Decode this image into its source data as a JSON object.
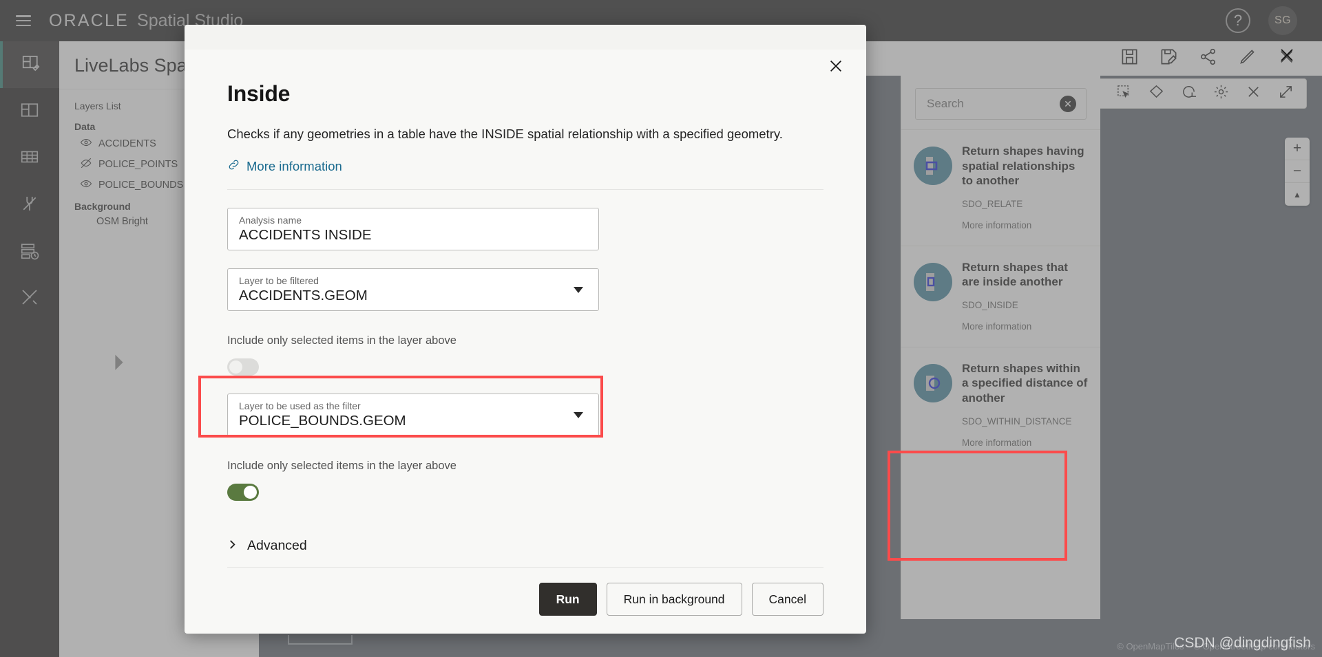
{
  "topbar": {
    "brand": "ORACLE",
    "brand_sub": "Spatial Studio",
    "help_glyph": "?",
    "avatar_initials": "SG"
  },
  "sidebar": {
    "rail_items": [
      {
        "name": "project-edit-icon",
        "active": true
      },
      {
        "name": "dataset-icon",
        "active": false
      },
      {
        "name": "table-icon",
        "active": false
      },
      {
        "name": "connection-icon",
        "active": false
      },
      {
        "name": "jobs-icon",
        "active": false
      },
      {
        "name": "tools-icon",
        "active": false
      }
    ],
    "project_title": "LiveLabs Spatial Studio",
    "layers_list_label": "Layers List",
    "groups": [
      {
        "label": "Data",
        "layers": [
          {
            "name": "ACCIDENTS",
            "visible": true
          },
          {
            "name": "POLICE_POINTS",
            "visible": false
          },
          {
            "name": "POLICE_BOUNDS",
            "visible": true
          }
        ]
      },
      {
        "label": "Background",
        "layers": [
          {
            "name": "OSM Bright",
            "visible": null
          }
        ]
      }
    ]
  },
  "map": {
    "toolbar_top_icons": [
      "save-icon",
      "save-as-icon",
      "share-icon",
      "edit-icon",
      "close-icon"
    ],
    "toolbar_secondary_icons": [
      "measure-icon",
      "box-select-icon",
      "shape-select-icon",
      "refresh-icon",
      "gear-icon",
      "clear-icon",
      "expand-icon"
    ],
    "zoom_in": "+",
    "zoom_out": "−",
    "zoom_reset": "▲",
    "attribution": [
      "© OpenMapTiles",
      "© OpenStreetMap contributors"
    ]
  },
  "analysis_panel": {
    "search": {
      "value": "",
      "placeholder": "Search"
    },
    "clear_glyph": "✕",
    "cards": [
      {
        "title": "Return shapes having spatial relationships to another",
        "code": "SDO_RELATE",
        "more": "More information",
        "highlighted": false
      },
      {
        "title": "Return shapes that are inside another",
        "code": "SDO_INSIDE",
        "more": "More information",
        "highlighted": false
      },
      {
        "title": "Return shapes within a specified distance of another",
        "code": "SDO_WITHIN_DISTANCE",
        "more": "More information",
        "highlighted": true
      }
    ]
  },
  "modal": {
    "title": "Inside",
    "description": "Checks if any geometries in a table have the INSIDE spatial relationship with a specified geometry.",
    "more_information": "More information",
    "fields": [
      {
        "label": "Analysis name",
        "value": "ACCIDENTS INSIDE",
        "type": "text",
        "name": "analysis-name-field"
      },
      {
        "label": "Layer to be filtered",
        "value": "ACCIDENTS.GEOM",
        "type": "select",
        "name": "layer-to-be-filtered-select"
      }
    ],
    "toggle_1": {
      "label": "Include only selected items in the layer above",
      "on": false
    },
    "filter_field": {
      "label": "Layer to be used as the filter",
      "value": "POLICE_BOUNDS.GEOM",
      "type": "select",
      "name": "layer-as-filter-select",
      "highlighted": true
    },
    "toggle_2": {
      "label": "Include only selected items in the layer above",
      "on": true
    },
    "advanced_label": "Advanced",
    "buttons": {
      "run": "Run",
      "run_background": "Run in background",
      "cancel": "Cancel"
    }
  },
  "watermark": "CSDN @dingdingfish",
  "colors": {
    "accent_green": "#5a7a40",
    "highlight_red": "#fb4b4b",
    "link_blue": "#1b6b8f",
    "icon_circle": "#3f7f96",
    "primary_button": "#312f2c"
  }
}
